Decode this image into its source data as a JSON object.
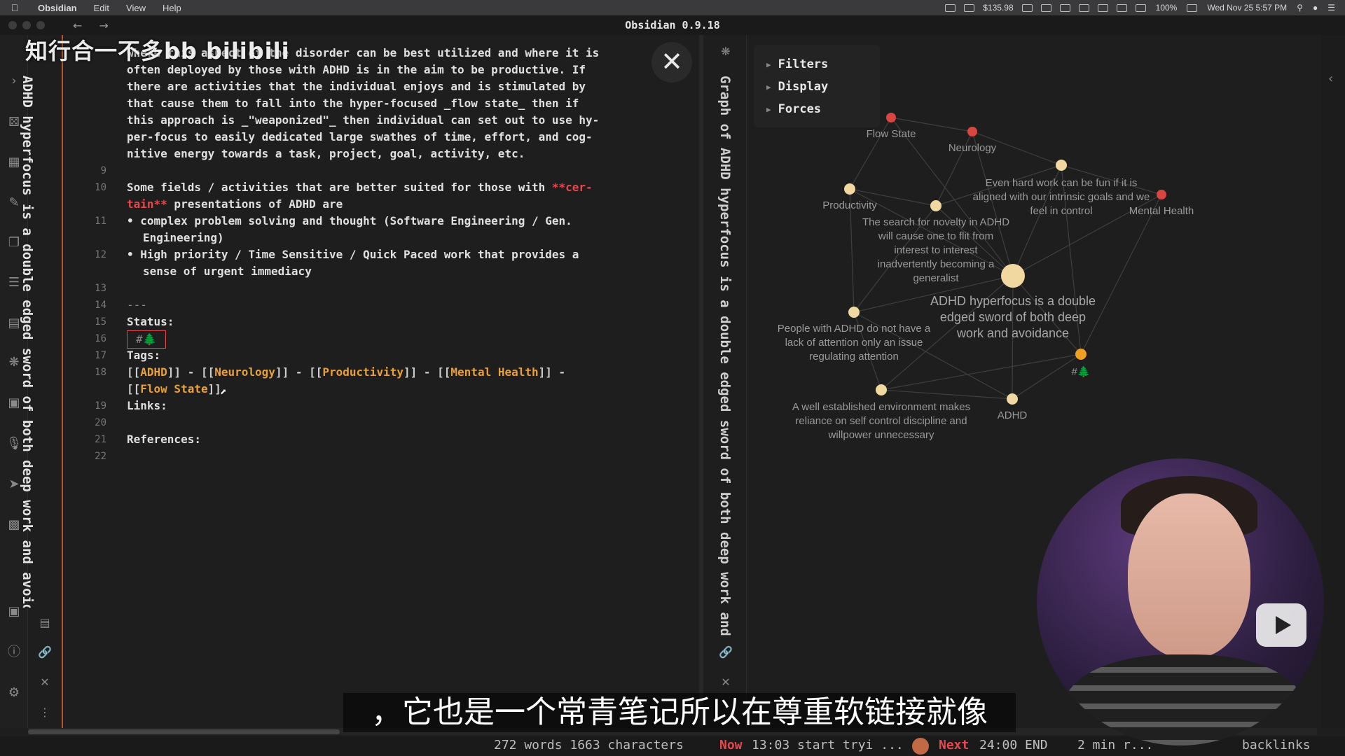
{
  "menubar": {
    "app": "Obsidian",
    "menus": [
      "Edit",
      "View",
      "Help"
    ],
    "price": "$135.98",
    "battery": "100%",
    "datetime": "Wed Nov 25  5:57 PM"
  },
  "window": {
    "title": "Obsidian 0.9.18"
  },
  "note": {
    "title": "ADHD hyperfocus is a double edged sword of both deep work and avoidance",
    "paragraph_lines": [
      "where this aspect of the disorder can be best utilized and where it is",
      "often deployed by those with ADHD is in the aim to be productive. If",
      "there are activities that the individual enjoys and is stimulated by",
      "that cause them to fall into the hyper-focused _flow state_ then if",
      "this approach is _\"weaponized\"_ then individual can set out to use hy-",
      "per-focus to easily dedicated large swathes of time, effort, and cog-",
      "nitive energy towards a task, project, goal, activity, etc."
    ],
    "line_numbers": [
      "9",
      "10",
      "11",
      "12",
      "13",
      "14",
      "15",
      "16",
      "17",
      "18",
      "19",
      "20",
      "21",
      "22"
    ],
    "fields_line_1a": "Some fields / activities that are better suited for those with ",
    "fields_line_1b": "**cer-",
    "fields_line_2a": "tain**",
    "fields_line_2b": " presentations of ADHD are",
    "bullet_1a": "complex problem solving and thought (Software Engineering / Gen.",
    "bullet_1b": "Engineering)",
    "bullet_2a": "High priority / Time Sensitive / Quick Paced work that provides a",
    "bullet_2b": "sense of urgent immediacy",
    "hr": "---",
    "status_label": "Status:",
    "status_tag": "#🌲",
    "tags_label": "Tags:",
    "tag_links": [
      "ADHD",
      "Neurology",
      "Productivity",
      "Mental  Health",
      "Flow State"
    ],
    "links_label": "Links:",
    "references_label": "References:"
  },
  "graph": {
    "title": "Graph of ADHD hyperfocus is a double edged sword of both deep work and avoidance",
    "controls": [
      "Filters",
      "Display",
      "Forces"
    ],
    "nodes": [
      {
        "label": "Flow State",
        "color": "#d9463f"
      },
      {
        "label": "Neurology",
        "color": "#d9463f"
      },
      {
        "label": "Mental Health",
        "color": "#d9463f"
      },
      {
        "label": "Productivity",
        "color": "#f1d7a0"
      },
      {
        "label": "Even hard work can be fun if it is aligned with our intrinsic goals and we feel in control",
        "color": "#f1d7a0"
      },
      {
        "label": "The search for novelty in ADHD will cause one to flit from interest to interest inadvertently becoming a generalist",
        "color": "#f1d7a0"
      },
      {
        "label": "ADHD hyperfocus is a double edged sword of both deep work and avoidance",
        "color": "#f1d7a0"
      },
      {
        "label": "People with ADHD do not have a lack of attention only an issue regulating attention",
        "color": "#f1d7a0"
      },
      {
        "label": "#🌲",
        "color": "#f0a020"
      },
      {
        "label": "A well established environment makes reliance on self control discipline and willpower unnecessary",
        "color": "#f1d7a0"
      },
      {
        "label": "ADHD",
        "color": "#f1d7a0"
      }
    ]
  },
  "statusbar": {
    "counts": "272 words 1663 characters",
    "now_label": "Now",
    "now_text": "13:03 start tryi ...",
    "next_label": "Next",
    "next_text": "24:00 END",
    "mins": "2 min r...",
    "backlinks": "backlinks"
  },
  "overlay": {
    "watermark": "知行合一不多bb bilibili",
    "subtitle": "，它也是一个常青笔记所以在尊重软链接就像"
  }
}
